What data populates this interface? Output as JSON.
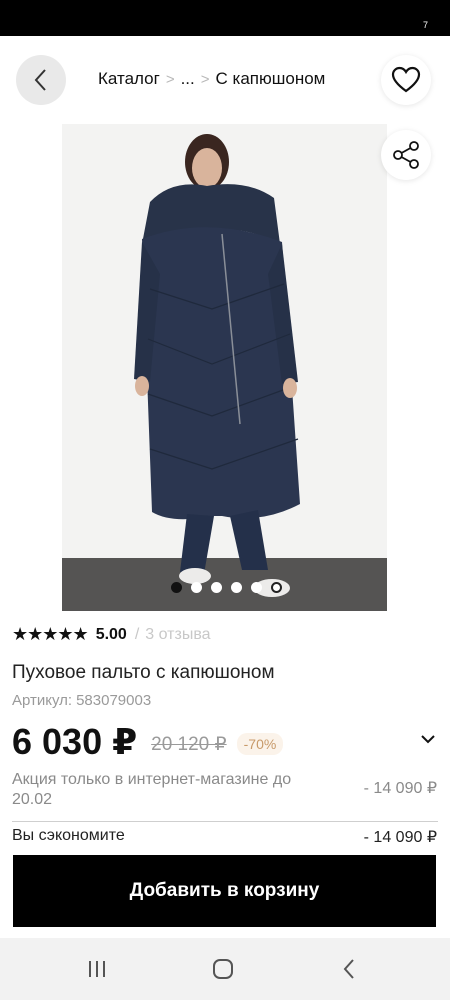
{
  "status_bar": {
    "indicator": "7"
  },
  "header": {
    "back_icon": "chevron-left-icon",
    "breadcrumb": [
      "Каталог",
      "...",
      "С капюшоном"
    ],
    "favorite_icon": "heart-icon"
  },
  "gallery": {
    "share_icon": "share-icon",
    "image_description": "Woman wearing long navy quilted hooded down coat",
    "slide_count": 6,
    "active_slide": 1
  },
  "product": {
    "rating": "5.00",
    "rating_sep": "/",
    "reviews": "3 отзыва",
    "title": "Пуховое пальто с капюшоном",
    "sku_label": "Артикул:",
    "sku_value": "583079003",
    "price": "6 030 ₽",
    "old_price": "20 120 ₽",
    "discount": "-70%",
    "promo_text": "Акция только в интернет-магазине до 20.02",
    "promo_amount": "- 14 090 ₽",
    "savings_label": "Вы сэкономите",
    "savings_amount": "- 14 090 ₽"
  },
  "cart": {
    "add_label": "Добавить в корзину"
  },
  "nav": {
    "icons": [
      "recent-apps-icon",
      "home-icon",
      "back-icon"
    ]
  },
  "colors": {
    "accent": "#000000",
    "discount_bg": "#fbf3ea",
    "discount_text": "#c89a6a"
  }
}
